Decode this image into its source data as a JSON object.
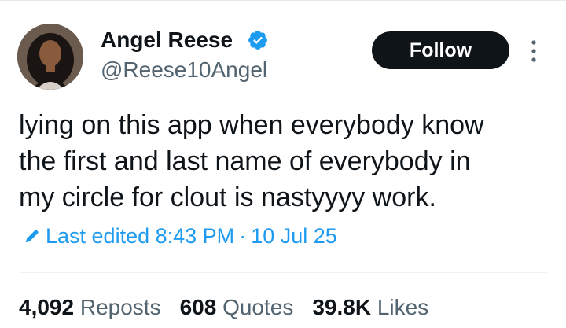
{
  "author": {
    "display_name": "Angel Reese",
    "handle": "@Reese10Angel",
    "verified": true,
    "avatar_icon": "profile-photo"
  },
  "follow_button": {
    "label": "Follow"
  },
  "more_icon": "more-vertical-icon",
  "tweet": {
    "lines": [
      "lying on this app when everybody know",
      "the first and last name of everybody in",
      "my circle for clout is nastyyyy work."
    ]
  },
  "edit_info": {
    "prefix": "Last edited",
    "time": "8:43 PM",
    "separator": "·",
    "date": "10 Jul 25"
  },
  "stats": {
    "reposts_count": "4,092",
    "reposts_label": "Reposts",
    "quotes_count": "608",
    "quotes_label": "Quotes",
    "likes_count": "39.8K",
    "likes_label": "Likes"
  },
  "colors": {
    "text_primary": "#0f1419",
    "text_secondary": "#536471",
    "accent_blue": "#1d9bf0",
    "button_bg": "#0f1419"
  }
}
